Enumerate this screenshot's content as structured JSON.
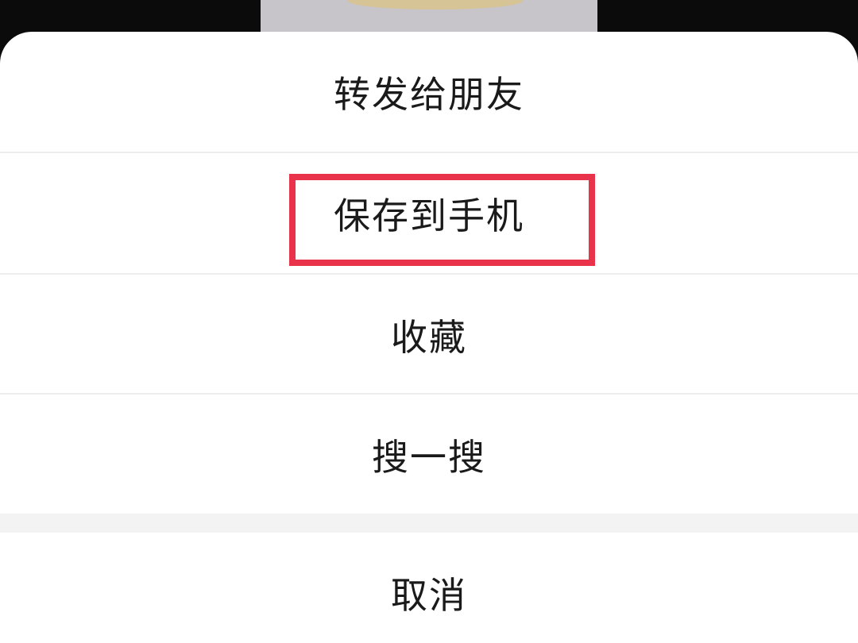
{
  "menu": {
    "items": [
      {
        "label": "转发给朋友"
      },
      {
        "label": "保存到手机"
      },
      {
        "label": "收藏"
      },
      {
        "label": "搜一搜"
      }
    ],
    "cancel_label": "取消"
  },
  "colors": {
    "highlight": "#e8334a",
    "sheet": "#ffffff",
    "divider": "#ededed",
    "gap": "#f3f3f3"
  }
}
